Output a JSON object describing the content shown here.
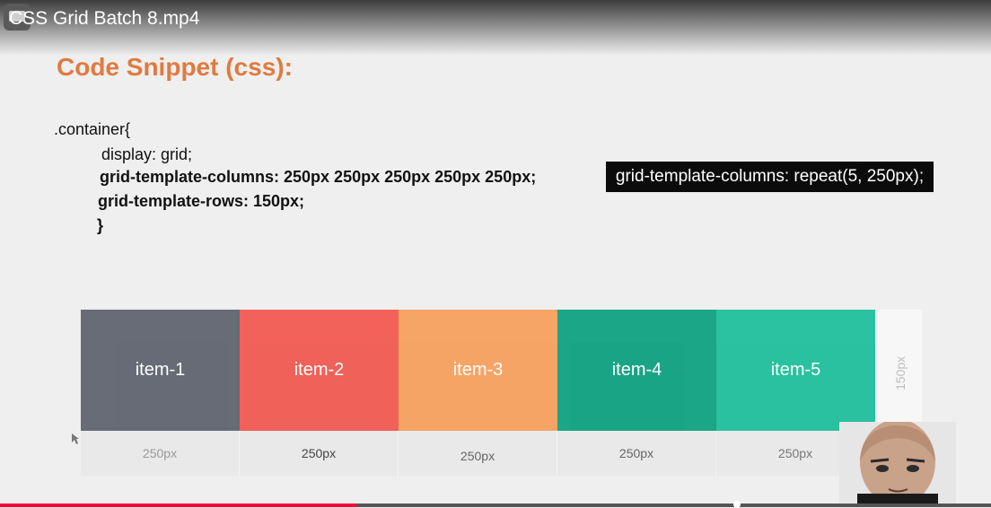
{
  "video": {
    "title": "CSS Grid Batch 8.mp4",
    "progress_percent": 36
  },
  "slide": {
    "heading": "Code Snippet (css):",
    "code_lines": [
      ".container{",
      "display: grid;",
      "grid-template-columns: 250px 250px 250px 250px 250px;",
      "grid-template-rows: 150px;",
      "}"
    ],
    "callout": "grid-template-columns: repeat(5, 250px);",
    "grid": {
      "items": [
        "item-1",
        "item-2",
        "item-3",
        "item-4",
        "item-5"
      ],
      "item_colors": [
        "#5f6470",
        "#f15a52",
        "#f7a05f",
        "#0ea181",
        "#1fbf9b"
      ],
      "row_height_label": "150px",
      "column_width_labels": [
        "250px",
        "250px",
        "250px",
        "250px",
        "250px"
      ]
    }
  },
  "colors": {
    "heading": "#e07a40",
    "progress": "#ff0033"
  }
}
